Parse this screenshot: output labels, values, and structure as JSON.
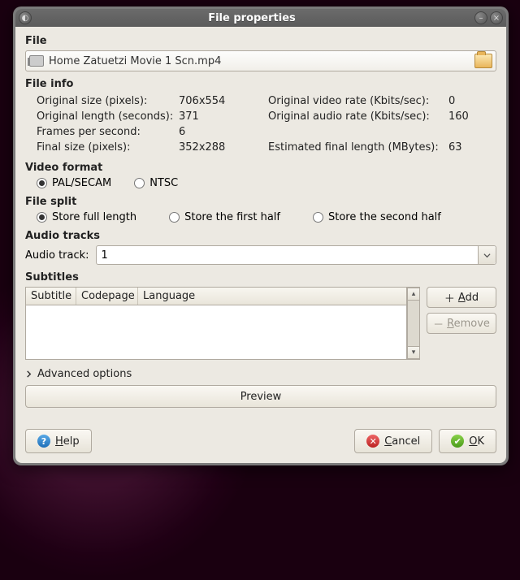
{
  "window": {
    "title": "File properties"
  },
  "file": {
    "section": "File",
    "path": "Home Zatuetzi Movie 1 Scn.mp4"
  },
  "file_info": {
    "section": "File info",
    "rows": [
      {
        "l1": "Original size (pixels):",
        "v1": "706x554",
        "l2": "Original video rate (Kbits/sec):",
        "v2": "0"
      },
      {
        "l1": "Original length (seconds):",
        "v1": "371",
        "l2": "Original audio rate (Kbits/sec):",
        "v2": "160"
      },
      {
        "l1": "Frames per second:",
        "v1": "6",
        "l2": "",
        "v2": ""
      },
      {
        "l1": "Final size (pixels):",
        "v1": "352x288",
        "l2": "Estimated final length (MBytes):",
        "v2": "63"
      }
    ]
  },
  "video_format": {
    "section": "Video format",
    "options": [
      "PAL/SECAM",
      "NTSC"
    ],
    "selected": "PAL/SECAM"
  },
  "file_split": {
    "section": "File split",
    "options": [
      "Store full length",
      "Store the first half",
      "Store the second half"
    ],
    "selected": "Store full length"
  },
  "audio": {
    "section": "Audio tracks",
    "label": "Audio track:",
    "value": "1"
  },
  "subtitles": {
    "section": "Subtitles",
    "cols": [
      "Subtitle",
      "Codepage",
      "Language"
    ],
    "add_label": "Add",
    "remove_label": "Remove"
  },
  "advanced": {
    "label": "Advanced options"
  },
  "preview": {
    "label": "Preview"
  },
  "footer": {
    "help": "Help",
    "cancel": "Cancel",
    "ok": "OK"
  }
}
